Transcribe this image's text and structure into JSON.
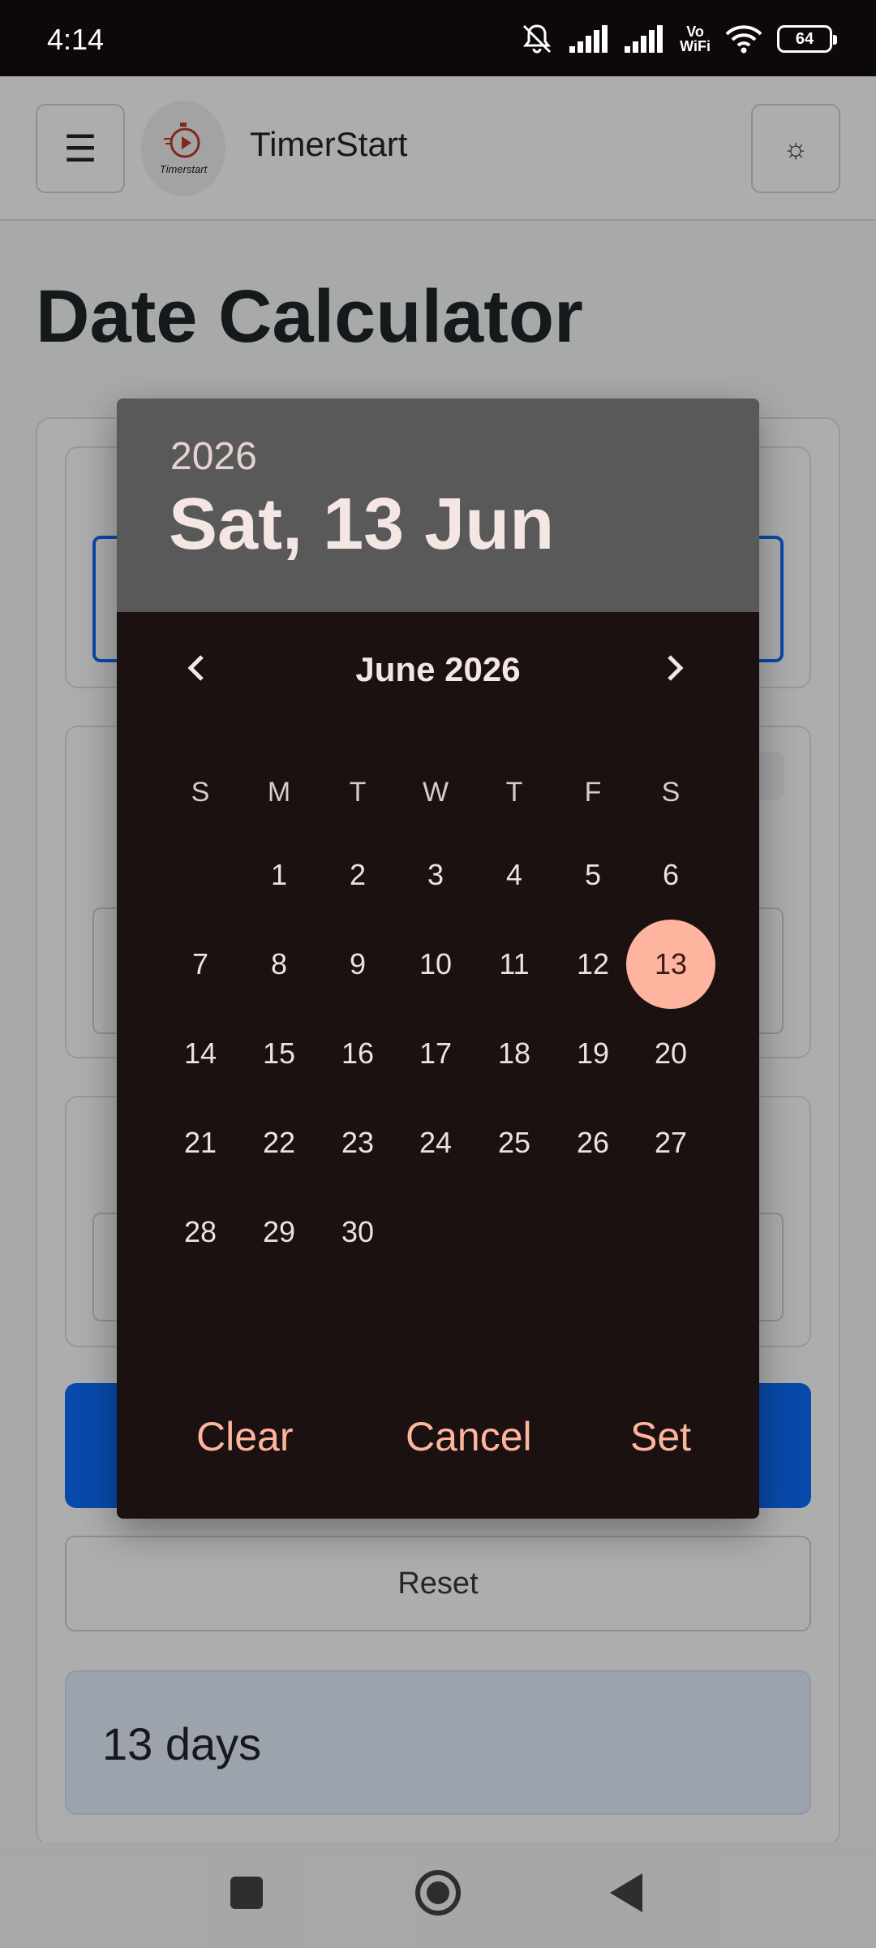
{
  "status_bar": {
    "time": "4:14",
    "volte_line1": "Vo",
    "volte_line2": "WiFi",
    "battery": "64"
  },
  "app": {
    "menu_icon": "☰",
    "logo_text": "Timerstart",
    "brand": "TimerStart",
    "theme_icon": "☼"
  },
  "page": {
    "title": "Date Calculator",
    "reset_label": "Reset",
    "result": "13 days"
  },
  "date_picker": {
    "year": "2026",
    "selected_date": "Sat, 13 Jun",
    "month_label": "June 2026",
    "weekdays": [
      "S",
      "M",
      "T",
      "W",
      "T",
      "F",
      "S"
    ],
    "days": [
      "1",
      "2",
      "3",
      "4",
      "5",
      "6",
      "7",
      "8",
      "9",
      "10",
      "11",
      "12",
      "13",
      "14",
      "15",
      "16",
      "17",
      "18",
      "19",
      "20",
      "21",
      "22",
      "23",
      "24",
      "25",
      "26",
      "27",
      "28",
      "29",
      "30"
    ],
    "first_day_offset": 1,
    "selected_day": 13,
    "buttons": {
      "clear": "Clear",
      "cancel": "Cancel",
      "set": "Set"
    }
  },
  "colors": {
    "accent": "#ffb4a0",
    "dialog_bg": "#1b1110",
    "header_bg": "#595959",
    "primary_button": "#0d6efd"
  }
}
